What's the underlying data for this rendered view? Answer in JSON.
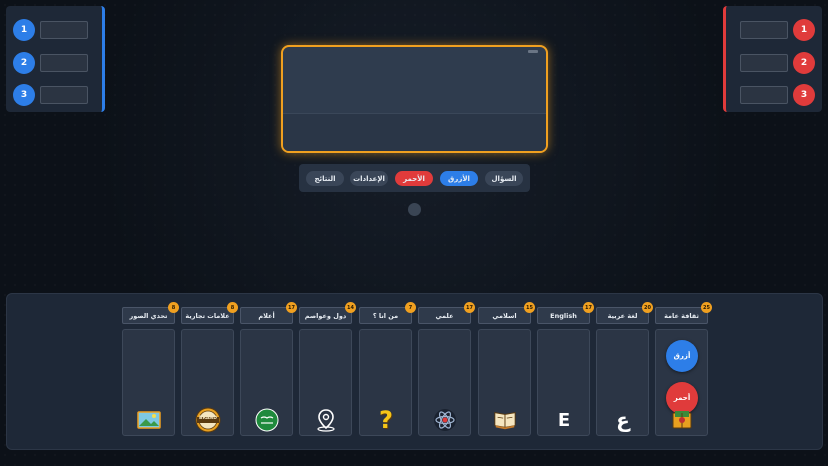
{
  "teams": {
    "blue": {
      "rows": [
        "1",
        "2",
        "3"
      ],
      "color": "#2d7ee8"
    },
    "red": {
      "rows": [
        "1",
        "2",
        "3"
      ],
      "color": "#e03b3b"
    }
  },
  "controls": {
    "question": "السؤال",
    "blue": "الأزرق",
    "red": "الأحمر",
    "settings": "الإعدادات",
    "results": "النتائج"
  },
  "accent_color": "#f0a020",
  "categories": [
    {
      "label": "ثقافة عامة",
      "count": "25",
      "icon": "book-icon"
    },
    {
      "label": "لغة عربية",
      "count": "20",
      "icon": "arabic-letter-icon"
    },
    {
      "label": "English",
      "count": "17",
      "icon": "letter-e-icon"
    },
    {
      "label": "اسلامي",
      "count": "15",
      "icon": "quran-icon"
    },
    {
      "label": "علمي",
      "count": "17",
      "icon": "atom-icon"
    },
    {
      "label": "من انا ؟",
      "count": "7",
      "icon": "question-mark-icon"
    },
    {
      "label": "دول وعواصم",
      "count": "14",
      "icon": "map-pin-icon"
    },
    {
      "label": "أعلام",
      "count": "17",
      "icon": "flag-icon"
    },
    {
      "label": "علامات تجارية",
      "count": "8",
      "icon": "brand-badge-icon"
    },
    {
      "label": "تحدي الصور",
      "count": "8",
      "icon": "picture-icon"
    }
  ],
  "icon_glyphs": {
    "arabic-letter": "ع",
    "letter-e": "E",
    "question-mark": "?",
    "brand": "BRAND"
  },
  "team_buttons": {
    "blue": "أزرق",
    "red": "أحمر"
  }
}
